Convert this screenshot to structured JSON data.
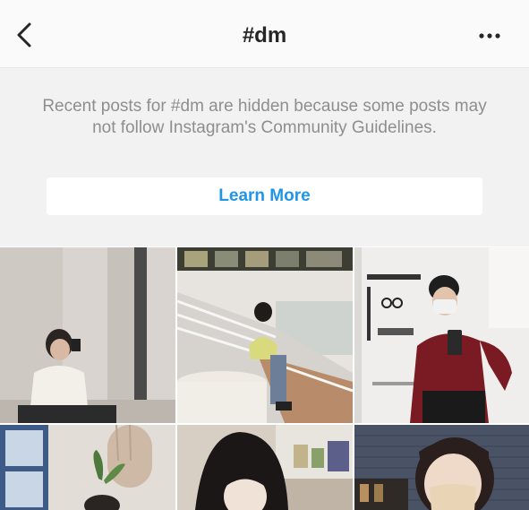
{
  "header": {
    "title": "#dm",
    "back_icon": "chevron-left-icon",
    "more_icon": "more-horizontal-icon"
  },
  "notice": {
    "message": "Recent posts for #dm are hidden because some posts may not follow Instagram's Community Guidelines.",
    "learn_more_label": "Learn More",
    "link_color": "#1f95e8"
  },
  "grid": {
    "posts": [
      {
        "label": "Post 1"
      },
      {
        "label": "Post 2"
      },
      {
        "label": "Post 3"
      },
      {
        "label": "Post 4"
      },
      {
        "label": "Post 5"
      },
      {
        "label": "Post 6"
      }
    ]
  }
}
